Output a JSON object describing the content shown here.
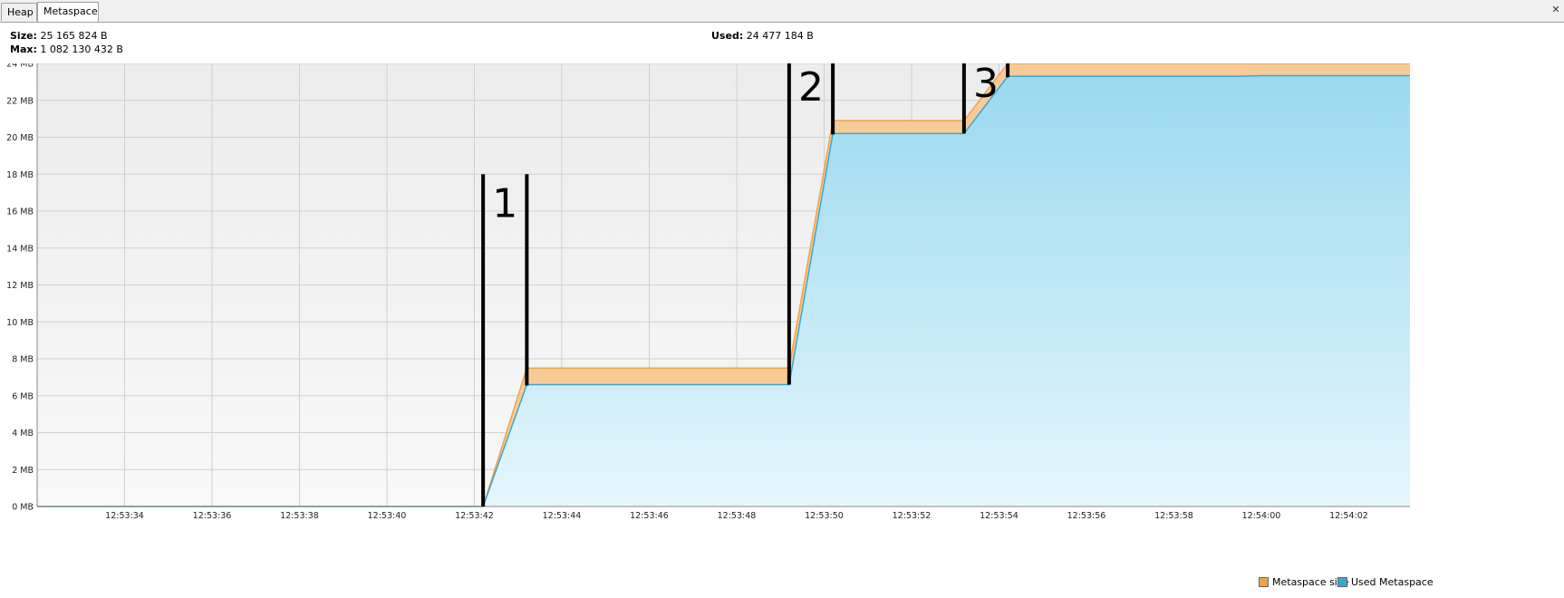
{
  "tabs": [
    {
      "label": "Heap"
    },
    {
      "label": "Metaspace"
    }
  ],
  "info": {
    "size_label": "Size:",
    "size_value": "25 165 824 B",
    "max_label": "Max:",
    "max_value": "1 082 130 432 B",
    "used_label": "Used:",
    "used_value": "24 477 184 B"
  },
  "colors": {
    "metaspace_size": "#f0a24a",
    "metaspace_size_fill": "#f8cb96",
    "used_metaspace": "#3aa7cf",
    "used_top_fill": "#9ad9ef",
    "used_bottom_fill": "#e5f6fc",
    "plot_bg": "#efefef",
    "grid": "#d0d0d0",
    "annotation": "#000000"
  },
  "chart_data": {
    "type": "area",
    "ylabel_unit": "MB",
    "ylim": [
      0,
      24
    ],
    "yticks": [
      "0 MB",
      "2 MB",
      "4 MB",
      "6 MB",
      "8 MB",
      "10 MB",
      "12 MB",
      "14 MB",
      "16 MB",
      "18 MB",
      "20 MB",
      "22 MB",
      "24 MB"
    ],
    "xlim": [
      "12:53:32",
      "12:54:03.4"
    ],
    "xticks": [
      "12:53:34",
      "12:53:36",
      "12:53:38",
      "12:53:40",
      "12:53:42",
      "12:53:44",
      "12:53:46",
      "12:53:48",
      "12:53:50",
      "12:53:52",
      "12:53:54",
      "12:53:56",
      "12:53:58",
      "12:54:00",
      "12:54:02"
    ],
    "grid": true,
    "legend_position": "bottom-right",
    "series": [
      {
        "name": "Metaspace size",
        "points": [
          [
            "12:53:32",
            0
          ],
          [
            "12:53:42.2",
            0
          ],
          [
            "12:53:43.2",
            7.5
          ],
          [
            "12:53:49.2",
            7.5
          ],
          [
            "12:53:50.2",
            20.9
          ],
          [
            "12:53:53.2",
            20.9
          ],
          [
            "12:53:54.2",
            24.0
          ],
          [
            "12:54:03.4",
            24.0
          ]
        ]
      },
      {
        "name": "Used Metaspace",
        "points": [
          [
            "12:53:32",
            0
          ],
          [
            "12:53:42.2",
            0
          ],
          [
            "12:53:43.2",
            6.6
          ],
          [
            "12:53:49.2",
            6.6
          ],
          [
            "12:53:50.2",
            20.2
          ],
          [
            "12:53:53.2",
            20.2
          ],
          [
            "12:53:54.2",
            23.3
          ],
          [
            "12:53:59.5",
            23.3
          ],
          [
            "12:54:00",
            23.34
          ],
          [
            "12:54:03.4",
            23.34
          ]
        ]
      }
    ],
    "annotations": [
      {
        "label": "1",
        "t1": "12:53:42.2",
        "t2": "12:53:43.2",
        "y1": 18.0,
        "y2": 18.0
      },
      {
        "label": "2",
        "t1": "12:53:49.2",
        "t2": "12:53:50.2",
        "y1": 24.3,
        "y2": 24.4
      },
      {
        "label": "3",
        "t1": "12:53:53.2",
        "t2": "12:53:54.2",
        "y1": 24.5,
        "y2": 24.6
      }
    ]
  }
}
